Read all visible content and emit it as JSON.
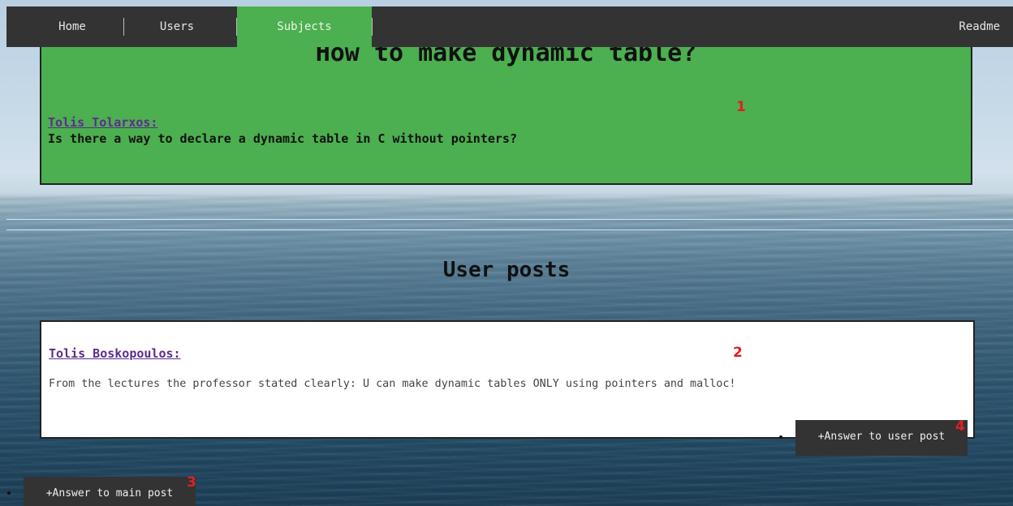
{
  "nav": {
    "items": [
      {
        "label": "Home"
      },
      {
        "label": "Users"
      },
      {
        "label": "Subjects"
      }
    ],
    "readme": "Readme",
    "active_color": "#4caf50"
  },
  "main_post": {
    "title": "How to make dynamic table?",
    "author": "Tolis Tolarxos:",
    "text": "Is there a way to declare a dynamic table in C without pointers?",
    "marker": "1"
  },
  "section": {
    "title": "User posts"
  },
  "user_post": {
    "author": "Tolis Boskopoulos:",
    "text": "From the lectures the professor stated clearly: U can make dynamic tables ONLY using pointers and malloc!",
    "marker": "2"
  },
  "buttons": {
    "answer_user": "+Answer to user post",
    "answer_user_marker": "4",
    "answer_main": "+Answer to main post",
    "answer_main_marker": "3"
  },
  "colors": {
    "navbar": "#333333",
    "post_green": "#4caf50",
    "link_purple": "#5b2d8e",
    "marker_red": "#e02020"
  }
}
